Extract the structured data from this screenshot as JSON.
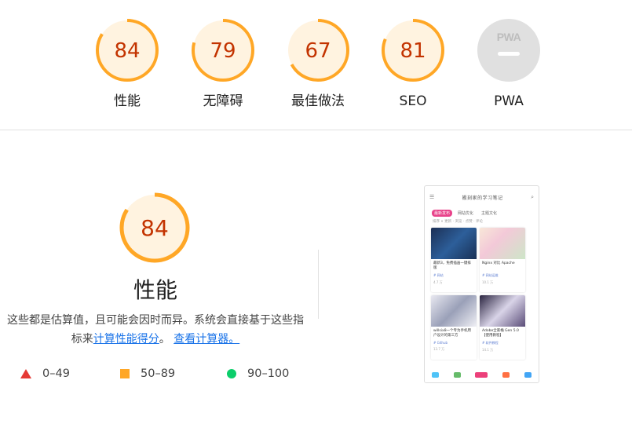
{
  "summary": {
    "gauges": [
      {
        "label": "性能",
        "score": "84",
        "value": 84
      },
      {
        "label": "无障碍",
        "score": "79",
        "value": 79
      },
      {
        "label": "最佳做法",
        "score": "67",
        "value": 67
      },
      {
        "label": "SEO",
        "score": "81",
        "value": 81
      },
      {
        "label": "PWA",
        "badge": "PWA"
      }
    ]
  },
  "performance": {
    "score": "84",
    "value": 84,
    "title": "性能",
    "desc_prefix": "这些都是估算值，且可能会因时而异。系统会直接基于这些指标来",
    "link_calc_score": "计算性能得分",
    "desc_mid": "。",
    "link_view_calc": "查看计算器。"
  },
  "legend": {
    "fail": "0–49",
    "average": "50–89",
    "pass": "90–100"
  },
  "colors": {
    "average_arc": "#ffa726",
    "average_fill": "#fff3e0",
    "average_text": "#c33300",
    "fail": "#e53935",
    "pass": "#0cce6b",
    "link": "#1a73e8"
  },
  "screenshot": {
    "site_title": "搬刻家的学习笔记",
    "tabs": [
      "最新发布",
      "网站优化",
      "主题文化"
    ],
    "sort": "排序 ∨   更新 · 浏览 · 点赞 · 评论",
    "cards": [
      {
        "title": "最新3，免费插画一键排版",
        "tag": "# 网站",
        "foot": "4.7 万"
      },
      {
        "title": "Nginx 对比 Apache",
        "tag": "# 网站运维",
        "foot": "10.1 万"
      },
      {
        "title": "willsix8一个专为手机用户设计的第三方",
        "tag": "# Github",
        "foot": "13.7 万"
      },
      {
        "title": "Adobe全家桶 Gen 5.0【使用教程】",
        "tag": "# 软件教程",
        "foot": "14.1 万"
      }
    ]
  }
}
